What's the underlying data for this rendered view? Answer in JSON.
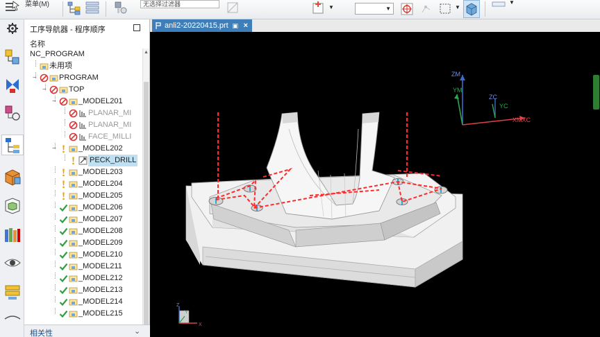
{
  "toolbar": {
    "menu_label": "菜单(M)",
    "filter_value": "无选择过滤器"
  },
  "tab": {
    "file_name": "anli2-20220415.prt",
    "close_glyph": "×"
  },
  "navigator": {
    "title": "工序导航器 - 程序顺序",
    "column_header": "名称",
    "footer_label": "相关性",
    "tree": [
      {
        "label": "NC_PROGRAM",
        "indent": 0,
        "status": "none",
        "icon": "none"
      },
      {
        "label": "未用项",
        "indent": 1,
        "status": "none",
        "icon": "folder"
      },
      {
        "label": "PROGRAM",
        "indent": 1,
        "status": "forbid",
        "icon": "folder"
      },
      {
        "label": "TOP",
        "indent": 2,
        "status": "forbid",
        "icon": "folder"
      },
      {
        "label": "_MODEL201",
        "indent": 3,
        "status": "forbid",
        "icon": "folder"
      },
      {
        "label": "PLANAR_MI",
        "indent": 4,
        "status": "forbid",
        "icon": "op",
        "dim": true
      },
      {
        "label": "PLANAR_MI",
        "indent": 4,
        "status": "forbid",
        "icon": "op",
        "dim": true
      },
      {
        "label": "FACE_MILLI",
        "indent": 4,
        "status": "forbid",
        "icon": "op",
        "dim": true
      },
      {
        "label": "_MODEL202",
        "indent": 3,
        "status": "warn",
        "icon": "folder"
      },
      {
        "label": "PECK_DRILL",
        "indent": 4,
        "status": "warn",
        "icon": "drill",
        "selected": true
      },
      {
        "label": "_MODEL203",
        "indent": 3,
        "status": "warn",
        "icon": "folder"
      },
      {
        "label": "_MODEL204",
        "indent": 3,
        "status": "warn",
        "icon": "folder"
      },
      {
        "label": "_MODEL205",
        "indent": 3,
        "status": "warn",
        "icon": "folder"
      },
      {
        "label": "_MODEL206",
        "indent": 3,
        "status": "ok",
        "icon": "folder"
      },
      {
        "label": "_MODEL207",
        "indent": 3,
        "status": "ok",
        "icon": "folder"
      },
      {
        "label": "_MODEL208",
        "indent": 3,
        "status": "ok",
        "icon": "folder"
      },
      {
        "label": "_MODEL209",
        "indent": 3,
        "status": "ok",
        "icon": "folder"
      },
      {
        "label": "_MODEL210",
        "indent": 3,
        "status": "ok",
        "icon": "folder"
      },
      {
        "label": "_MODEL211",
        "indent": 3,
        "status": "ok",
        "icon": "folder"
      },
      {
        "label": "_MODEL212",
        "indent": 3,
        "status": "ok",
        "icon": "folder"
      },
      {
        "label": "_MODEL213",
        "indent": 3,
        "status": "ok",
        "icon": "folder"
      },
      {
        "label": "_MODEL214",
        "indent": 3,
        "status": "ok",
        "icon": "folder"
      },
      {
        "label": "_MODEL215",
        "indent": 3,
        "status": "ok",
        "icon": "folder"
      }
    ]
  },
  "viewport": {
    "mcs_axes": {
      "zm": "ZM",
      "ym": "YM",
      "zc": "ZC",
      "yc": "YC",
      "xmxc": "XMXC"
    },
    "wcs_axes": {
      "z": "Z",
      "y": "Y",
      "x": "X"
    }
  },
  "colors": {
    "tab_active": "#3f7fb9",
    "tool_path": "#ff2a2a",
    "axis_z": "#3c6cc9",
    "axis_y": "#2fa74f",
    "axis_x": "#e0414a",
    "status_ok": "#2f9e3f",
    "status_warn": "#e8a400",
    "status_forbid": "#d93333"
  }
}
